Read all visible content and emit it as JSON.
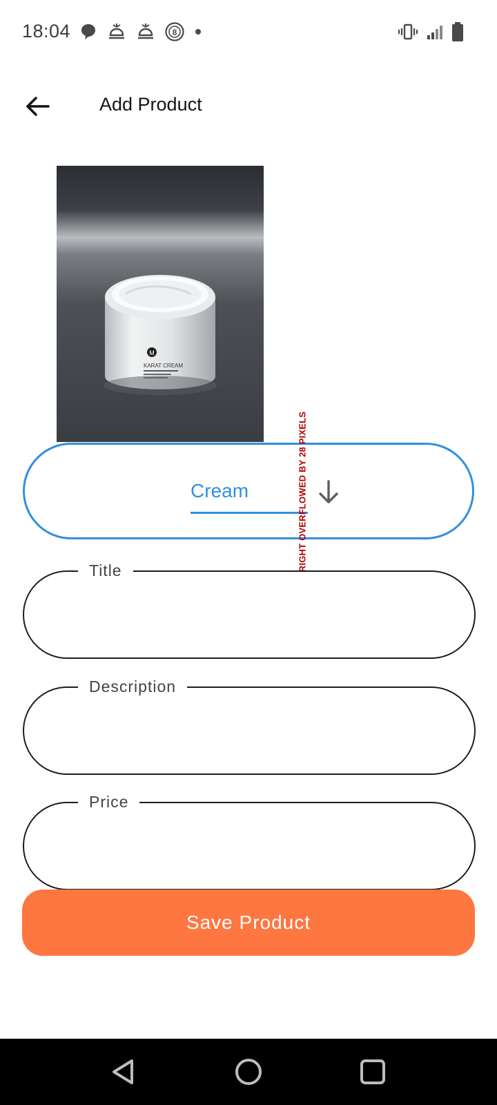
{
  "status_bar": {
    "time": "18:04",
    "left_icons": [
      "chat-bubble-icon",
      "alarm-icon",
      "alarm-icon",
      "badge-8-icon",
      "dot-icon"
    ],
    "badge_number": "8",
    "right_icons": [
      "vibrate-icon",
      "signal-icon",
      "battery-icon"
    ]
  },
  "app_bar": {
    "title": "Add Product",
    "back_icon": "arrow-back-icon"
  },
  "product_image": {
    "label": "KARAT CREAM",
    "brand": "M"
  },
  "category": {
    "selected": "Cream",
    "icon": "arrow-down-icon"
  },
  "debug": {
    "overflow_text": "RIGHT OVERFLOWED BY 28 PIXELS"
  },
  "form": {
    "title_label": "Title",
    "title_value": "",
    "description_label": "Description",
    "description_value": "",
    "price_label": "Price",
    "price_value": ""
  },
  "save_button": {
    "label": "Save Product"
  },
  "nav_bar": {
    "icons": [
      "nav-back-icon",
      "nav-home-icon",
      "nav-recents-icon"
    ]
  },
  "colors": {
    "accent_blue": "#2f8fe0",
    "save_orange": "#fe7741",
    "overflow_red": "#b00000"
  }
}
